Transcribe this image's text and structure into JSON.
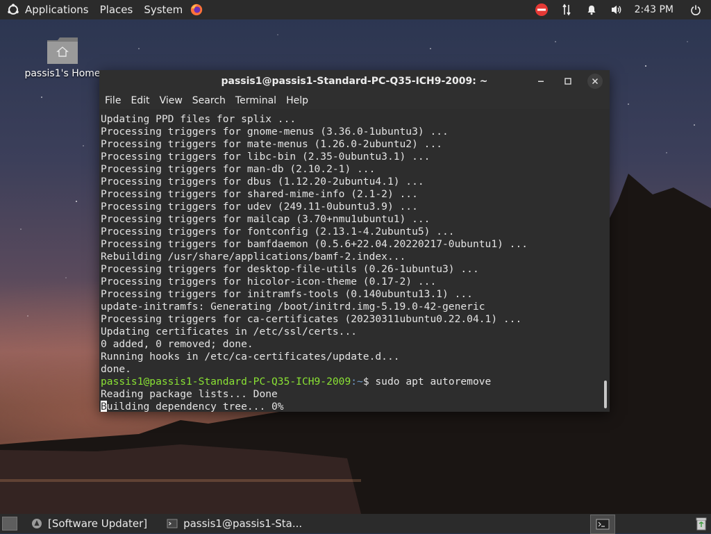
{
  "top_panel": {
    "menus": [
      "Applications",
      "Places",
      "System"
    ],
    "clock": "2:43 PM"
  },
  "desktop": {
    "home_icon_label": "passis1's Home"
  },
  "terminal": {
    "title": "passis1@passis1-Standard-PC-Q35-ICH9-2009: ~",
    "menu": [
      "File",
      "Edit",
      "View",
      "Search",
      "Terminal",
      "Help"
    ],
    "lines": [
      "Updating PPD files for splix ...",
      "Processing triggers for gnome-menus (3.36.0-1ubuntu3) ...",
      "Processing triggers for mate-menus (1.26.0-2ubuntu2) ...",
      "Processing triggers for libc-bin (2.35-0ubuntu3.1) ...",
      "Processing triggers for man-db (2.10.2-1) ...",
      "Processing triggers for dbus (1.12.20-2ubuntu4.1) ...",
      "Processing triggers for shared-mime-info (2.1-2) ...",
      "Processing triggers for udev (249.11-0ubuntu3.9) ...",
      "Processing triggers for mailcap (3.70+nmu1ubuntu1) ...",
      "Processing triggers for fontconfig (2.13.1-4.2ubuntu5) ...",
      "Processing triggers for bamfdaemon (0.5.6+22.04.20220217-0ubuntu1) ...",
      "Rebuilding /usr/share/applications/bamf-2.index...",
      "Processing triggers for desktop-file-utils (0.26-1ubuntu3) ...",
      "Processing triggers for hicolor-icon-theme (0.17-2) ...",
      "Processing triggers for initramfs-tools (0.140ubuntu13.1) ...",
      "update-initramfs: Generating /boot/initrd.img-5.19.0-42-generic",
      "Processing triggers for ca-certificates (20230311ubuntu0.22.04.1) ...",
      "Updating certificates in /etc/ssl/certs...",
      "0 added, 0 removed; done.",
      "Running hooks in /etc/ca-certificates/update.d...",
      "done."
    ],
    "prompt_user": "passis1@passis1-Standard-PC-Q35-ICH9-2009",
    "prompt_path": ":~",
    "prompt_command": "$ sudo apt autoremove",
    "after_lines": [
      "Reading package lists... Done"
    ],
    "cursor_char": "B",
    "last_line_rest": "uilding dependency tree... 0%"
  },
  "bottom_panel": {
    "tasks": [
      "[Software Updater]",
      "passis1@passis1-Sta..."
    ]
  }
}
